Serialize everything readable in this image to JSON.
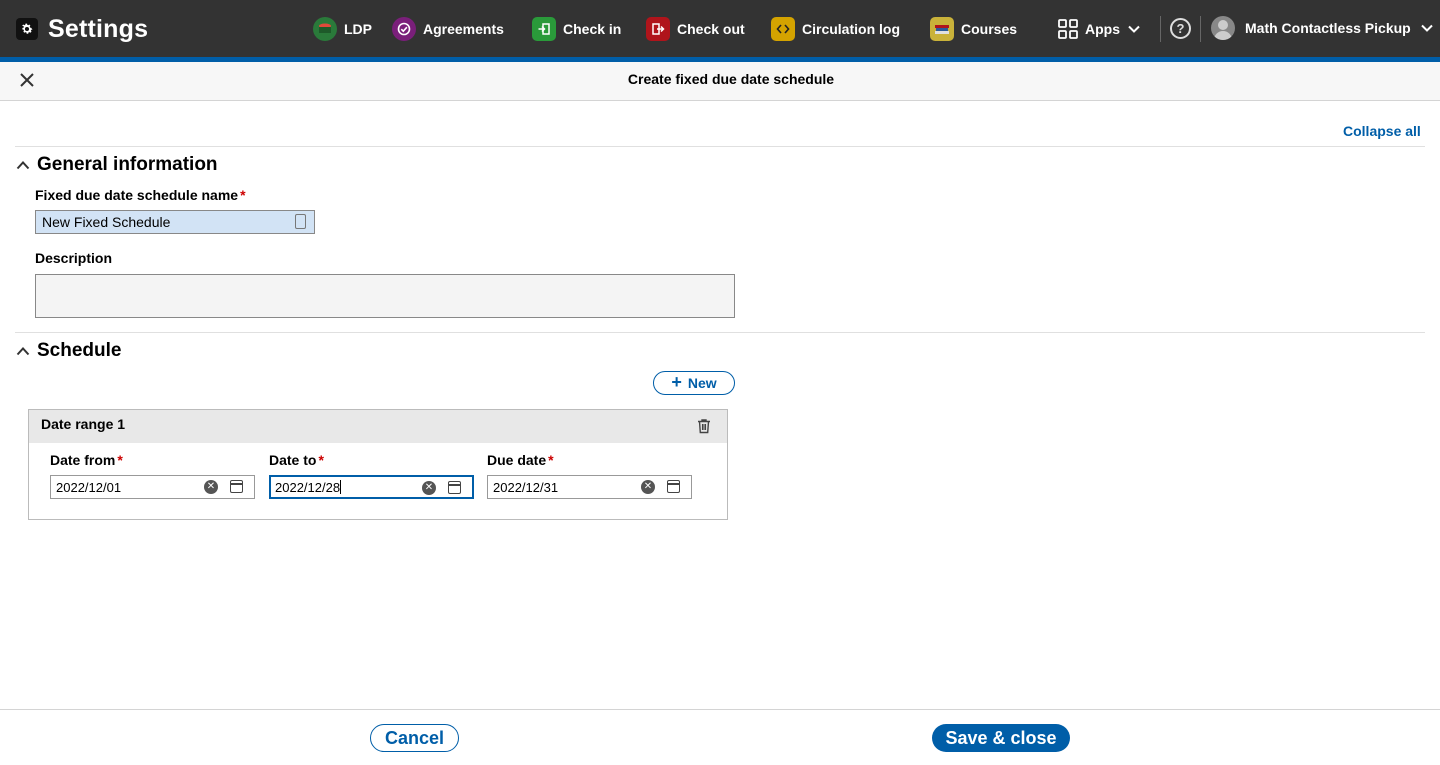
{
  "app": {
    "title": "Settings"
  },
  "nav": {
    "items": [
      {
        "label": "LDP",
        "icon": "ldp-icon",
        "color": "#2a7a3a"
      },
      {
        "label": "Agreements",
        "icon": "agreements-icon",
        "color": "#7a1f7a"
      },
      {
        "label": "Check in",
        "icon": "check-in-icon",
        "color": "#2a9a3a"
      },
      {
        "label": "Check out",
        "icon": "check-out-icon",
        "color": "#b0141b"
      },
      {
        "label": "Circulation log",
        "icon": "circulation-log-icon",
        "color": "#d4a300"
      },
      {
        "label": "Courses",
        "icon": "courses-icon",
        "color": "#c9b23a"
      }
    ],
    "apps_label": "Apps",
    "user_label": "Math Contactless Pickup"
  },
  "pane": {
    "title": "Create fixed due date schedule",
    "collapse_all": "Collapse all"
  },
  "general": {
    "heading": "General information",
    "name_label": "Fixed due date schedule name",
    "name_value": "New Fixed Schedule",
    "description_label": "Description",
    "description_value": ""
  },
  "schedule": {
    "heading": "Schedule",
    "new_label": "New",
    "ranges": [
      {
        "title": "Date range 1",
        "date_from_label": "Date from",
        "date_from": "2022/12/01",
        "date_to_label": "Date to",
        "date_to": "2022/12/28",
        "due_date_label": "Due date",
        "due_date": "2022/12/31"
      }
    ]
  },
  "required_mark": "*",
  "footer": {
    "cancel_label": "Cancel",
    "save_label": "Save & close"
  },
  "colors": {
    "accent": "#005ea8",
    "topbar": "#333333",
    "required": "#cc0000"
  }
}
